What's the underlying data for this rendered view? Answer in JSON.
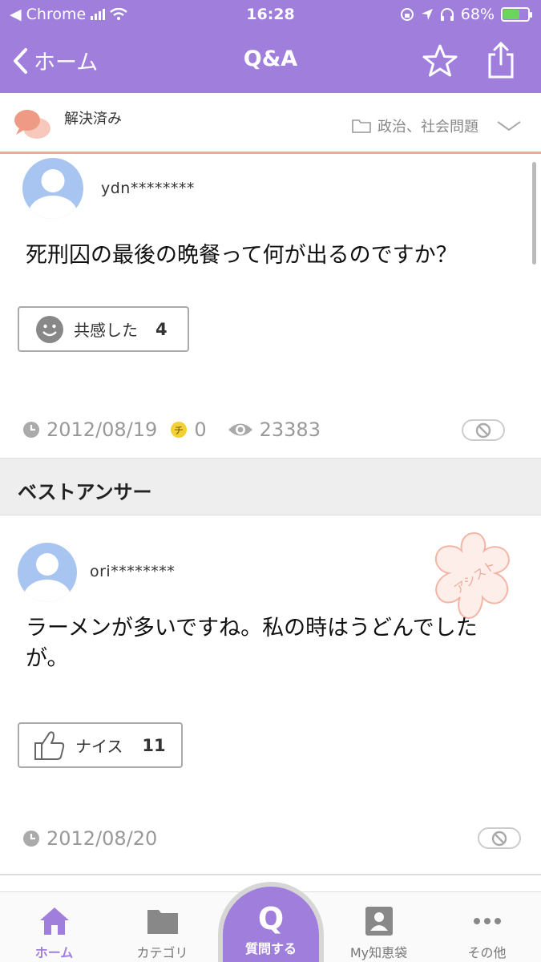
{
  "status_bar": {
    "carrier": "◀ Chrome",
    "time": "16:28",
    "battery": "68%",
    "battery_level": 0.68
  },
  "nav": {
    "back_label": "ホーム",
    "title": "Q&A"
  },
  "question": {
    "status": "解決済み",
    "category": "政治、社会問題",
    "username": "ydn********",
    "text": "死刑囚の最後の晩餐って何が出るのですか？",
    "empathy_label": "共感した",
    "empathy_count": "4",
    "date": "2012/08/19",
    "coin_count": "0",
    "view_count": "23383"
  },
  "best_answer": {
    "section_label": "ベストアンサー",
    "username": "ori********",
    "stamp_text": "アシスト",
    "text": "ラーメンが多いですね。私の時はうどんでしたが。",
    "nice_label": "ナイス",
    "nice_count": "11",
    "date": "2012/08/20"
  },
  "tabbar": {
    "home": "ホーム",
    "category": "カテゴリ",
    "ask": "質問する",
    "ask_icon": "Q",
    "mybag": "My知恵袋",
    "other": "その他"
  },
  "colors": {
    "brand_purple": "#a07edc",
    "accent_salmon": "#f2a896"
  }
}
